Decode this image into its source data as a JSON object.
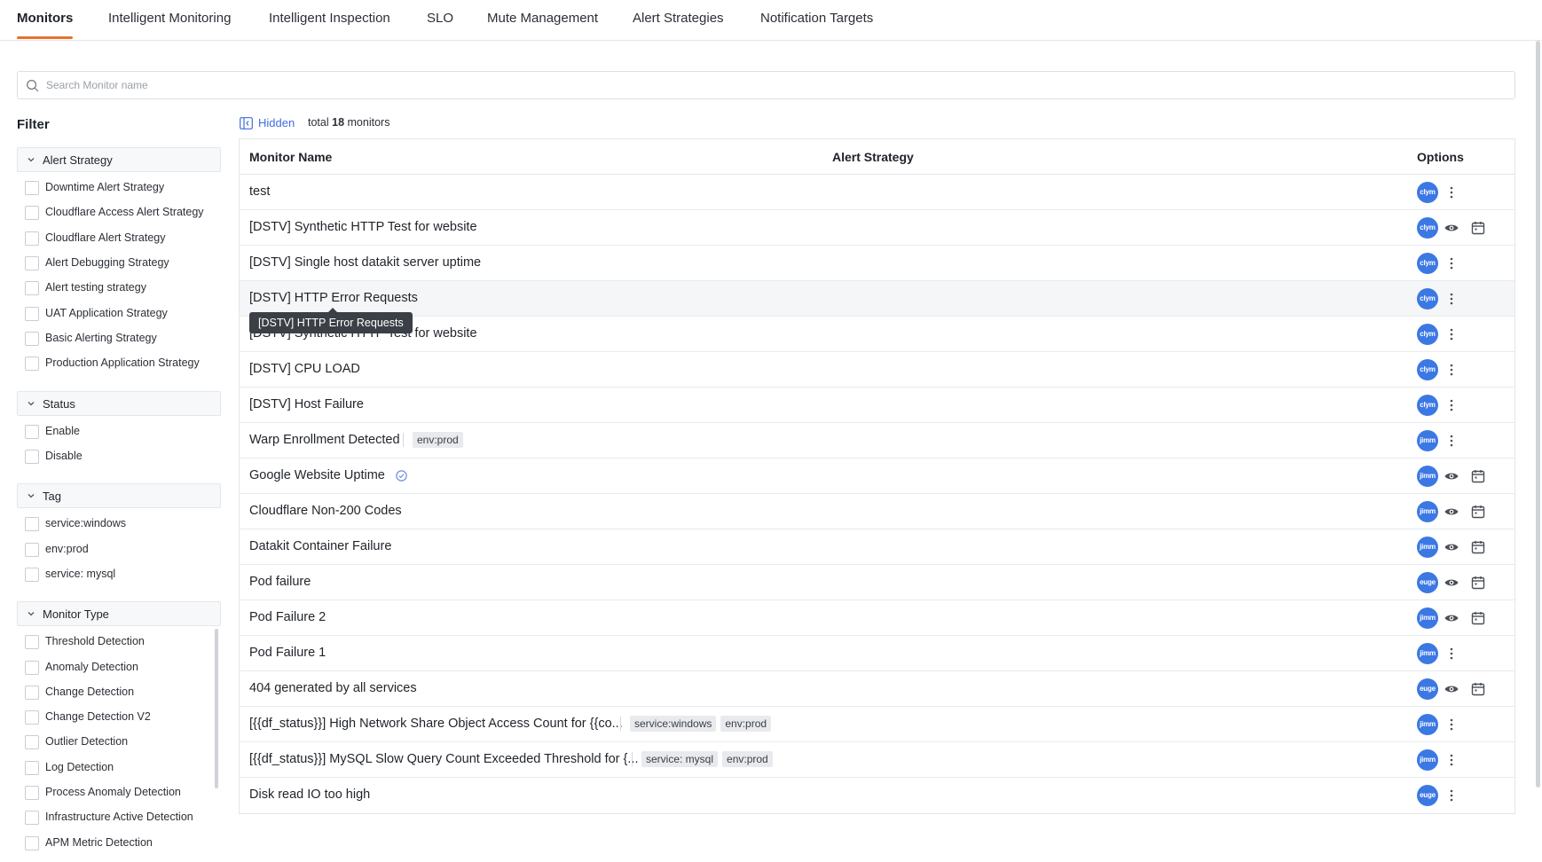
{
  "tabs": [
    {
      "label": "Monitors",
      "active": true
    },
    {
      "label": "Intelligent Monitoring"
    },
    {
      "label": "Intelligent Inspection"
    },
    {
      "label": "SLO"
    },
    {
      "label": "Mute Management"
    },
    {
      "label": "Alert Strategies"
    },
    {
      "label": "Notification Targets"
    }
  ],
  "search": {
    "placeholder": "Search Monitor name",
    "value": ""
  },
  "filter": {
    "title": "Filter",
    "groups": [
      {
        "label": "Alert Strategy",
        "options": [
          "Downtime Alert Strategy",
          "Cloudflare Access Alert Strategy",
          "Cloudflare Alert Strategy",
          "Alert Debugging Strategy",
          "Alert testing strategy",
          "UAT Application Strategy",
          "Basic Alerting Strategy",
          "Production Application Strategy"
        ]
      },
      {
        "label": "Status",
        "options": [
          "Enable",
          "Disable"
        ]
      },
      {
        "label": "Tag",
        "options": [
          "service:windows",
          "env:prod",
          "service: mysql"
        ]
      },
      {
        "label": "Monitor Type",
        "options": [
          "Threshold Detection",
          "Anomaly Detection",
          "Change Detection",
          "Change Detection V2",
          "Outlier Detection",
          "Log Detection",
          "Process Anomaly Detection",
          "Infrastructure Active Detection",
          "APM Metric Detection"
        ]
      }
    ]
  },
  "list": {
    "hidden_label": "Hidden",
    "total_prefix": "total",
    "total_count": "18",
    "total_suffix": "monitors",
    "columns": {
      "name": "Monitor Name",
      "strategy": "Alert Strategy",
      "options": "Options"
    }
  },
  "monitors": [
    {
      "name": "test",
      "tags": [],
      "avatar": "clym",
      "actions": [
        "more"
      ]
    },
    {
      "name": "[DSTV] Synthetic HTTP Test for website",
      "tags": [],
      "avatar": "clym",
      "actions": [
        "view",
        "schedule"
      ]
    },
    {
      "name": "[DSTV] Single host datakit server uptime",
      "tags": [],
      "avatar": "clym",
      "actions": [
        "more"
      ]
    },
    {
      "name": "[DSTV] HTTP Error Requests",
      "tags": [],
      "avatar": "clym",
      "actions": [
        "more"
      ],
      "hover": true
    },
    {
      "name": "[DSTV] Synthetic HTTP Test for website",
      "tags": [],
      "avatar": "clym",
      "actions": [
        "more"
      ]
    },
    {
      "name": "[DSTV] CPU LOAD",
      "tags": [],
      "avatar": "clym",
      "actions": [
        "more"
      ]
    },
    {
      "name": "[DSTV] Host Failure",
      "tags": [],
      "avatar": "clym",
      "actions": [
        "more"
      ]
    },
    {
      "name": "Warp Enrollment Detected",
      "tags": [
        "env:prod"
      ],
      "avatar": "jimm",
      "actions": [
        "more"
      ]
    },
    {
      "name": "Google Website Uptime",
      "tags": [],
      "avatar": "jimm",
      "actions": [
        "view",
        "schedule"
      ],
      "verified": true
    },
    {
      "name": "Cloudflare Non-200 Codes",
      "tags": [],
      "avatar": "jimm",
      "actions": [
        "view",
        "schedule"
      ]
    },
    {
      "name": "Datakit Container Failure",
      "tags": [],
      "avatar": "jimm",
      "actions": [
        "view",
        "schedule"
      ]
    },
    {
      "name": "Pod failure",
      "tags": [],
      "avatar": "euge",
      "actions": [
        "view",
        "schedule"
      ]
    },
    {
      "name": "Pod Failure 2",
      "tags": [],
      "avatar": "jimm",
      "actions": [
        "view",
        "schedule"
      ]
    },
    {
      "name": "Pod Failure 1",
      "tags": [],
      "avatar": "jimm",
      "actions": [
        "more"
      ]
    },
    {
      "name": "404 generated by all services",
      "tags": [],
      "avatar": "euge",
      "actions": [
        "view",
        "schedule"
      ]
    },
    {
      "name": "[{{df_status}}] High Network Share Object Access Count for {{co...",
      "tags": [
        "service:windows",
        "env:prod"
      ],
      "avatar": "jimm",
      "actions": [
        "more"
      ]
    },
    {
      "name": "[{{df_status}}] MySQL Slow Query Count Exceeded Threshold for {...",
      "tags": [
        "service: mysql",
        "env:prod"
      ],
      "avatar": "jimm",
      "actions": [
        "more"
      ]
    },
    {
      "name": "Disk read IO too high",
      "tags": [],
      "avatar": "euge",
      "actions": [
        "more"
      ]
    }
  ],
  "tooltip": {
    "text": "[DSTV] HTTP Error Requests"
  },
  "colors": {
    "accent": "#e8722e",
    "link": "#3d6fe0",
    "avatar": "#3c78e4"
  }
}
